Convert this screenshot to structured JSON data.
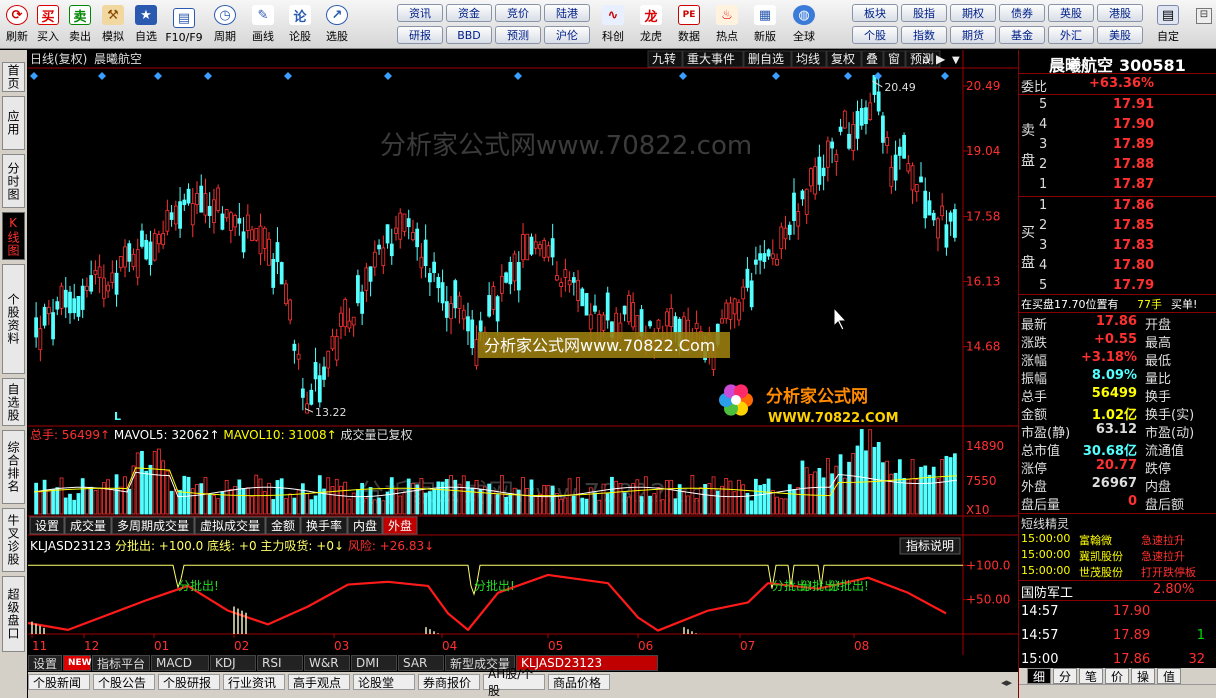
{
  "toolbar": {
    "left": [
      {
        "label": "刷新",
        "icon": "refresh-icon"
      },
      {
        "label": "买入",
        "icon": "buy-icon",
        "glyph": "买"
      },
      {
        "label": "卖出",
        "icon": "sell-icon",
        "glyph": "卖"
      },
      {
        "label": "模拟",
        "icon": "gavel-icon"
      },
      {
        "label": "自选",
        "icon": "star-icon"
      },
      {
        "label": "F10/F9",
        "icon": "f10-icon"
      },
      {
        "label": "周期",
        "icon": "clock-icon"
      },
      {
        "label": "画线",
        "icon": "pencil-icon"
      },
      {
        "label": "论股",
        "icon": "discuss-icon"
      },
      {
        "label": "选股",
        "icon": "select-icon"
      }
    ],
    "pills": [
      [
        "资讯",
        "资金",
        "竞价",
        "陆港"
      ],
      [
        "研报",
        "BBD",
        "预测",
        "沪伦"
      ]
    ],
    "right_btns": [
      {
        "label": "科创",
        "icon": "kechuang-icon"
      },
      {
        "label": "龙虎",
        "icon": "dragon-icon"
      },
      {
        "label": "数据",
        "icon": "pe-icon",
        "glyph": "PE"
      },
      {
        "label": "热点",
        "icon": "hot-icon"
      },
      {
        "label": "新版",
        "icon": "new-icon"
      },
      {
        "label": "全球",
        "icon": "globe-icon"
      }
    ],
    "pills2": [
      [
        "板块",
        "股指",
        "期权",
        "债券",
        "英股",
        "港股"
      ],
      [
        "个股",
        "指数",
        "期货",
        "基金",
        "外汇",
        "美股"
      ]
    ],
    "custom": {
      "label": "自定",
      "icon": "custom-icon"
    }
  },
  "leftnav": [
    "首页",
    "应用",
    "分时图",
    "K线图",
    "个股资料",
    "自选股",
    "综合排名",
    "牛叉诊股",
    "超级盘口"
  ],
  "leftnav_active": 3,
  "chart_header": {
    "period": "日线(复权)",
    "name": "晨曦航空",
    "buttons": [
      "九转",
      "重大事件",
      "删自选",
      "均线",
      "复权",
      "叠",
      "窗",
      "预测"
    ]
  },
  "chart_data": {
    "type": "candlestick",
    "ylim": [
      13.0,
      20.8
    ],
    "price_ticks": [
      "20.49",
      "19.04",
      "17.58",
      "16.13",
      "14.68"
    ],
    "price_tick_values": [
      20.49,
      19.04,
      17.58,
      16.13,
      14.68
    ],
    "high_label": "20.49",
    "low_label": "13.22",
    "watermark": "分析家公式网www.70822.com",
    "watermark_box": "分析家公式网www.70822.Com",
    "logo_text": "分析家公式网",
    "logo_url": "WWW.70822.COM",
    "month_labels": [
      "11",
      "12",
      "01",
      "02",
      "03",
      "04",
      "05",
      "06",
      "07",
      "08"
    ],
    "volume": {
      "label": "总手: 56499↑",
      "ma5": "MAVOL5: 32062↑",
      "ma10": "MAVOL10: 31008↑",
      "note": "成交量已复权",
      "ticks": [
        "14890",
        "7550"
      ],
      "unit": "X10",
      "ylim": [
        0,
        16000
      ]
    },
    "indicator": {
      "label": "KLJASD23123",
      "items": [
        "分批出: +100.0",
        "底线: +0",
        "主力吸货: +0↓",
        "风险: +26.83↓"
      ],
      "ticks": [
        "+100.0",
        "+50.00"
      ],
      "button": "指标说明",
      "signal": "分批出!",
      "ylim": [
        0,
        115
      ]
    }
  },
  "vol_tabs": [
    "设置",
    "成交量",
    "多周期成交量",
    "虚拟成交量",
    "金额",
    "换手率",
    "内盘",
    "外盘"
  ],
  "vol_tab_active": 7,
  "bottom_tabs": [
    "设置",
    "NEW",
    "指标平台",
    "MACD",
    "KDJ",
    "RSI",
    "W&R",
    "DMI",
    "SAR",
    "新型成交量",
    "KLJASD23123"
  ],
  "bottom_news": [
    "个股新闻",
    "个股公告",
    "个股研报",
    "行业资讯",
    "高手观点",
    "论股堂",
    "券商报价",
    "AH股/个股",
    "商品价格"
  ],
  "quote": {
    "title": "晨曦航空",
    "code": "300581",
    "weibi_label": "委比",
    "weibi": "+63.36%",
    "sell_label": [
      "卖",
      "盘"
    ],
    "buy_label": [
      "买",
      "盘"
    ],
    "sells": [
      [
        "5",
        "17.91"
      ],
      [
        "4",
        "17.90"
      ],
      [
        "3",
        "17.89"
      ],
      [
        "2",
        "17.88"
      ],
      [
        "1",
        "17.87"
      ]
    ],
    "buys": [
      [
        "1",
        "17.86"
      ],
      [
        "2",
        "17.85"
      ],
      [
        "3",
        "17.83"
      ],
      [
        "4",
        "17.80"
      ],
      [
        "5",
        "17.79"
      ]
    ],
    "pending": "在买盘17.70位置有",
    "pending_qty": "77手",
    "pending_btn": "买单!",
    "fields": [
      [
        "最新",
        "17.86",
        "开盘",
        ""
      ],
      [
        "涨跌",
        "+0.55",
        "最高",
        ""
      ],
      [
        "涨幅",
        "+3.18%",
        "最低",
        ""
      ],
      [
        "振幅",
        "8.09%",
        "量比",
        ""
      ],
      [
        "总手",
        "56499",
        "换手",
        ""
      ],
      [
        "金额",
        "1.02亿",
        "换手(实)",
        ""
      ],
      [
        "市盈(静)",
        "63.12",
        "市盈(动)",
        ""
      ],
      [
        "总市值",
        "30.68亿",
        "流通值",
        ""
      ],
      [
        "涨停",
        "20.77",
        "跌停",
        ""
      ],
      [
        "外盘",
        "26967",
        "内盘",
        ""
      ],
      [
        "盘后量",
        "0",
        "盘后额",
        ""
      ]
    ],
    "short_title": "短线精灵",
    "short": [
      [
        "15:00:00",
        "富翰微",
        "急速拉升"
      ],
      [
        "15:00:00",
        "冀凯股份",
        "急速拉升"
      ],
      [
        "15:00:00",
        "世茂股份",
        "打开跌停板"
      ]
    ],
    "sector": "国防军工",
    "sector_pct": "2.80%",
    "ticks": [
      [
        "14:57",
        "17.90",
        ""
      ],
      [
        "14:57",
        "17.89",
        "1"
      ],
      [
        "15:00",
        "17.86",
        "32"
      ]
    ],
    "footer_tabs": [
      "细",
      "分",
      "笔",
      "价",
      "操",
      "值"
    ]
  }
}
